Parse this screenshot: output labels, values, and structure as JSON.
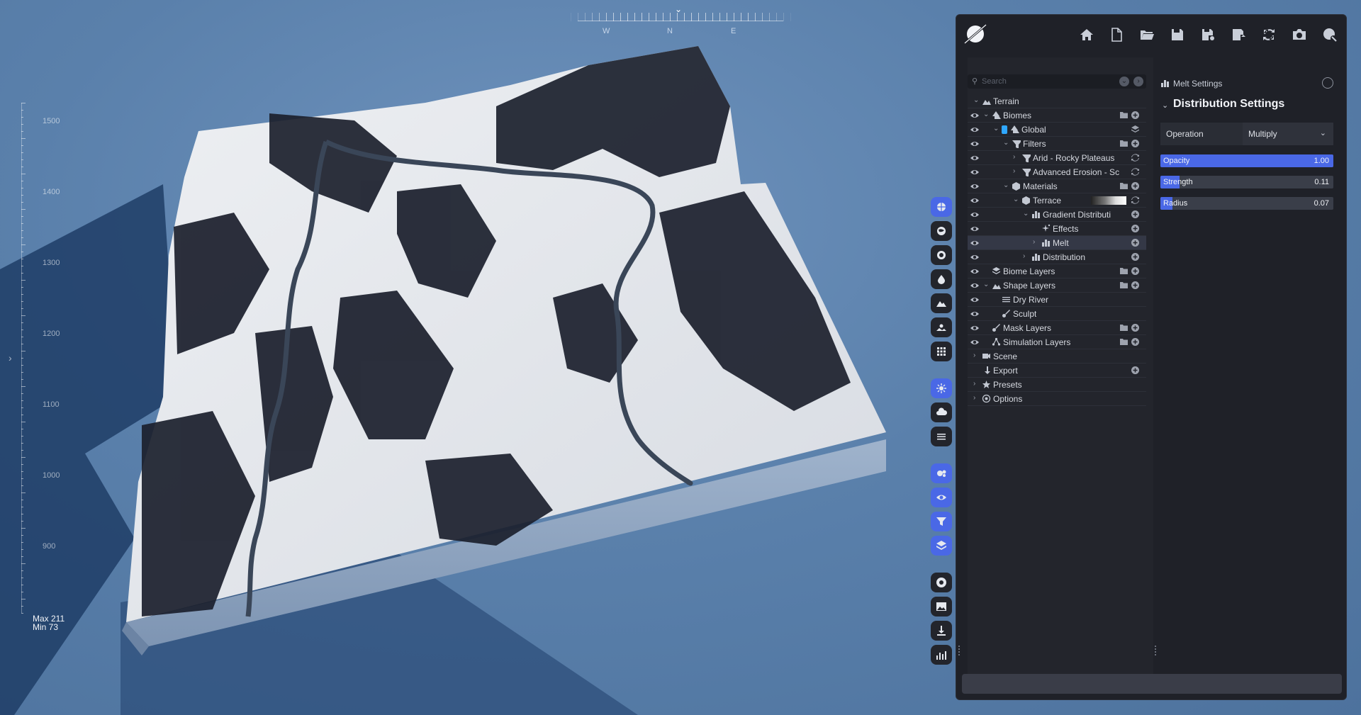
{
  "viewport": {
    "compass": {
      "west": "W",
      "north": "N",
      "east": "E"
    },
    "elevation_ticks": [
      "1500",
      "1400",
      "1300",
      "1200",
      "1100",
      "1000",
      "900"
    ],
    "max_label": "Max 211",
    "min_label": "Min 73"
  },
  "toolbar": {
    "buttons": [
      "home-icon",
      "new-file-icon",
      "open-folder-icon",
      "save-icon",
      "save-as-icon",
      "export-icon",
      "refresh-icon",
      "camera-icon",
      "help-icon"
    ]
  },
  "toolstrip": {
    "buttons": [
      {
        "icon": "globe-icon",
        "active": true
      },
      {
        "icon": "earth-icon",
        "active": false
      },
      {
        "icon": "target-icon",
        "active": false
      },
      {
        "icon": "water-drop-icon",
        "active": false
      },
      {
        "icon": "mountain-icon",
        "active": false
      },
      {
        "icon": "sun-landscape-icon",
        "active": false
      },
      {
        "icon": "grid-icon",
        "active": false
      },
      {
        "icon": "sun-icon",
        "active": true
      },
      {
        "icon": "cloud-icon",
        "active": false
      },
      {
        "icon": "fog-icon",
        "active": false
      },
      {
        "icon": "settings-eye-icon",
        "active": true
      },
      {
        "icon": "eye-icon",
        "active": true
      },
      {
        "icon": "filter-icon",
        "active": true
      },
      {
        "icon": "layers-icon",
        "active": true
      },
      {
        "icon": "record-icon",
        "active": false
      },
      {
        "icon": "image-icon",
        "active": false
      },
      {
        "icon": "download-icon",
        "active": false
      },
      {
        "icon": "stats-icon",
        "active": false
      }
    ]
  },
  "search": {
    "placeholder": "Search"
  },
  "tree": [
    {
      "label": "Terrain",
      "eye": false,
      "depth": 0,
      "chev": "down",
      "icon": "terrain-icon",
      "actions": []
    },
    {
      "label": "Biomes",
      "eye": true,
      "depth": 1,
      "chev": "down",
      "icon": "biome-icon",
      "actions": [
        "folder-icon",
        "add-icon"
      ]
    },
    {
      "label": "Global",
      "eye": true,
      "depth": 2,
      "chev": "down",
      "icon": "biome-icon",
      "swatch": true,
      "actions": [
        "layers-small-icon"
      ]
    },
    {
      "label": "Filters",
      "eye": true,
      "depth": 3,
      "chev": "down",
      "icon": "filter-icon",
      "actions": [
        "folder-icon",
        "add-icon"
      ]
    },
    {
      "label": "Arid - Rocky Plateaus",
      "eye": true,
      "depth": 4,
      "chev": "right",
      "icon": "filter-icon",
      "actions": [
        "sync-icon"
      ]
    },
    {
      "label": "Advanced Erosion - Sc",
      "eye": true,
      "depth": 4,
      "chev": "right",
      "icon": "filter-icon",
      "actions": [
        "sync-icon"
      ]
    },
    {
      "label": "Materials",
      "eye": true,
      "depth": 3,
      "chev": "down",
      "icon": "cube-icon",
      "actions": [
        "folder-icon",
        "add-icon"
      ]
    },
    {
      "label": "Terrace",
      "eye": true,
      "depth": 4,
      "chev": "down",
      "icon": "cube-icon",
      "gradient": true,
      "actions": [
        "sync-icon"
      ]
    },
    {
      "label": "Gradient Distributi",
      "eye": true,
      "depth": 5,
      "chev": "down",
      "icon": "distribution-icon",
      "actions": [
        "add-icon"
      ]
    },
    {
      "label": "Effects",
      "eye": true,
      "depth": 6,
      "chev": "",
      "icon": "effects-icon",
      "actions": [
        "add-icon"
      ]
    },
    {
      "label": "Melt",
      "eye": true,
      "depth": 6,
      "chev": "right",
      "icon": "distribution-icon",
      "selected": true,
      "actions": [
        "add-icon"
      ]
    },
    {
      "label": "Distribution",
      "eye": true,
      "depth": 5,
      "chev": "right",
      "icon": "distribution-icon",
      "actions": [
        "add-icon"
      ]
    },
    {
      "label": "Biome Layers",
      "eye": true,
      "depth": 1,
      "chev": "",
      "icon": "stack-icon",
      "actions": [
        "folder-icon",
        "add-icon"
      ]
    },
    {
      "label": "Shape Layers",
      "eye": true,
      "depth": 1,
      "chev": "down",
      "icon": "terrain-icon",
      "actions": [
        "folder-icon",
        "add-icon"
      ]
    },
    {
      "label": "Dry River",
      "eye": true,
      "depth": 2,
      "chev": "",
      "icon": "lines-icon",
      "actions": []
    },
    {
      "label": "Sculpt",
      "eye": true,
      "depth": 2,
      "chev": "",
      "icon": "brush-icon",
      "actions": []
    },
    {
      "label": "Mask Layers",
      "eye": true,
      "depth": 1,
      "chev": "",
      "icon": "brush-icon",
      "actions": [
        "folder-icon",
        "add-icon"
      ]
    },
    {
      "label": "Simulation Layers",
      "eye": true,
      "depth": 1,
      "chev": "",
      "icon": "network-icon",
      "actions": [
        "folder-icon",
        "add-icon"
      ]
    },
    {
      "label": "Scene",
      "eye": false,
      "depth": 0,
      "chev": "right",
      "icon": "video-icon",
      "actions": []
    },
    {
      "label": "Export",
      "eye": false,
      "depth": 0,
      "chev": "",
      "icon": "download-icon",
      "actions": [
        "add-icon"
      ]
    },
    {
      "label": "Presets",
      "eye": false,
      "depth": 0,
      "chev": "right",
      "icon": "star-icon",
      "actions": []
    },
    {
      "label": "Options",
      "eye": false,
      "depth": 0,
      "chev": "right",
      "icon": "gear-icon",
      "actions": []
    }
  ],
  "settings": {
    "header": "Melt Settings",
    "section": "Distribution Settings",
    "operation_label": "Operation",
    "operation_value": "Multiply",
    "sliders": [
      {
        "label": "Opacity",
        "value": "1.00",
        "fraction": 1.0
      },
      {
        "label": "Strength",
        "value": "0.11",
        "fraction": 0.11
      },
      {
        "label": "Radius",
        "value": "0.07",
        "fraction": 0.07
      }
    ]
  },
  "colors": {
    "accent": "#4a68e6",
    "panel_bg": "#1f2128",
    "viewport_bg": "#5a7ea8"
  }
}
